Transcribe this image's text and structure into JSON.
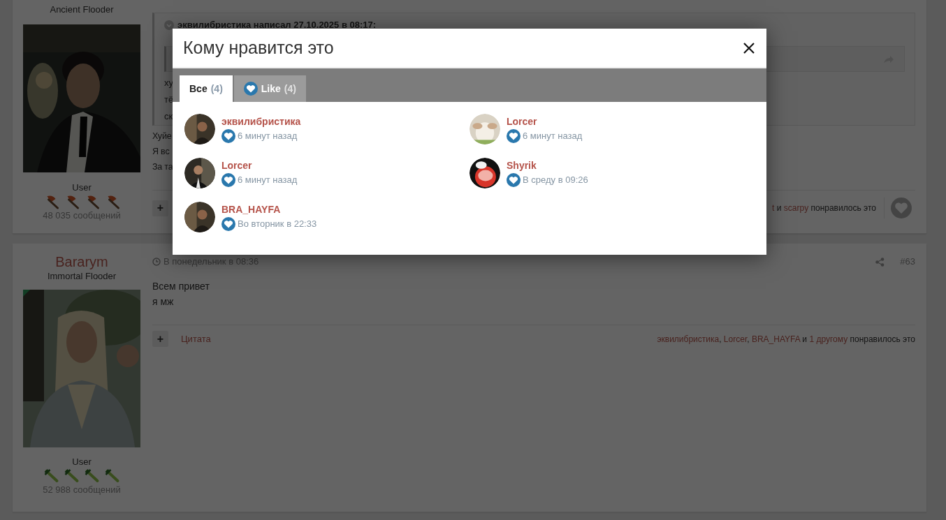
{
  "posts": [
    {
      "user_title": "Ancient Flooder",
      "rank": "User",
      "rank_icons": [
        {
          "kind": "axe"
        },
        {
          "kind": "axe"
        },
        {
          "kind": "axe"
        },
        {
          "kind": "axe"
        }
      ],
      "message_count": "48 035 сообщений",
      "online": false,
      "quote": {
        "header": "эквилибристика написал 27.10.2025 в 08:17:",
        "lines": [
          "ху",
          "тё",
          "ск"
        ]
      },
      "body": [
        "Хуйе",
        "Я вс",
        "За та"
      ],
      "footer": {
        "add": "+",
        "likes": [
          {
            "kind": "link",
            "text": "t"
          },
          {
            "kind": "plain",
            "text": " и "
          },
          {
            "kind": "link",
            "text": "scarpy"
          },
          {
            "kind": "plain",
            "text": " понравилось это"
          }
        ],
        "like_button": true
      }
    },
    {
      "username": "Bararym",
      "user_title": "Immortal Flooder",
      "rank": "User",
      "rank_icons": [
        {
          "kind": "sword"
        },
        {
          "kind": "sword"
        },
        {
          "kind": "sword"
        },
        {
          "kind": "sword"
        }
      ],
      "message_count": "52 988 сообщений",
      "online": true,
      "date": "В понедельник в 08:36",
      "number": "#63",
      "body": [
        "Всем привет",
        "я мж"
      ],
      "footer": {
        "add": "+",
        "quote_link": "Цитата",
        "likes": [
          {
            "kind": "link",
            "text": "эквилибристика"
          },
          {
            "kind": "plain",
            "text": ", "
          },
          {
            "kind": "link",
            "text": "Lorcer"
          },
          {
            "kind": "plain",
            "text": ", "
          },
          {
            "kind": "link",
            "text": "BRA_HAYFA"
          },
          {
            "kind": "plain",
            "text": " и "
          },
          {
            "kind": "link",
            "text": "1 другому"
          },
          {
            "kind": "plain",
            "text": " понравилось это"
          }
        ],
        "like_button": false
      }
    }
  ],
  "modal": {
    "title": "Кому нравится это",
    "tabs": [
      {
        "kind": "all",
        "label": "Все",
        "count": "(4)",
        "selected": true
      },
      {
        "kind": "like",
        "label": "Like",
        "count": "(4)",
        "selected": false
      }
    ],
    "likers": [
      {
        "name": "эквилибристика",
        "time": "6 минут назад"
      },
      {
        "name": "Lorcer",
        "time": "6 минут назад"
      },
      {
        "name": "Lorcer",
        "time": "6 минут назад"
      },
      {
        "name": "Shyrik",
        "time": "В среду в 09:26"
      },
      {
        "name": "BRA_HAYFA",
        "time": "Во вторник в 22:33"
      }
    ]
  }
}
